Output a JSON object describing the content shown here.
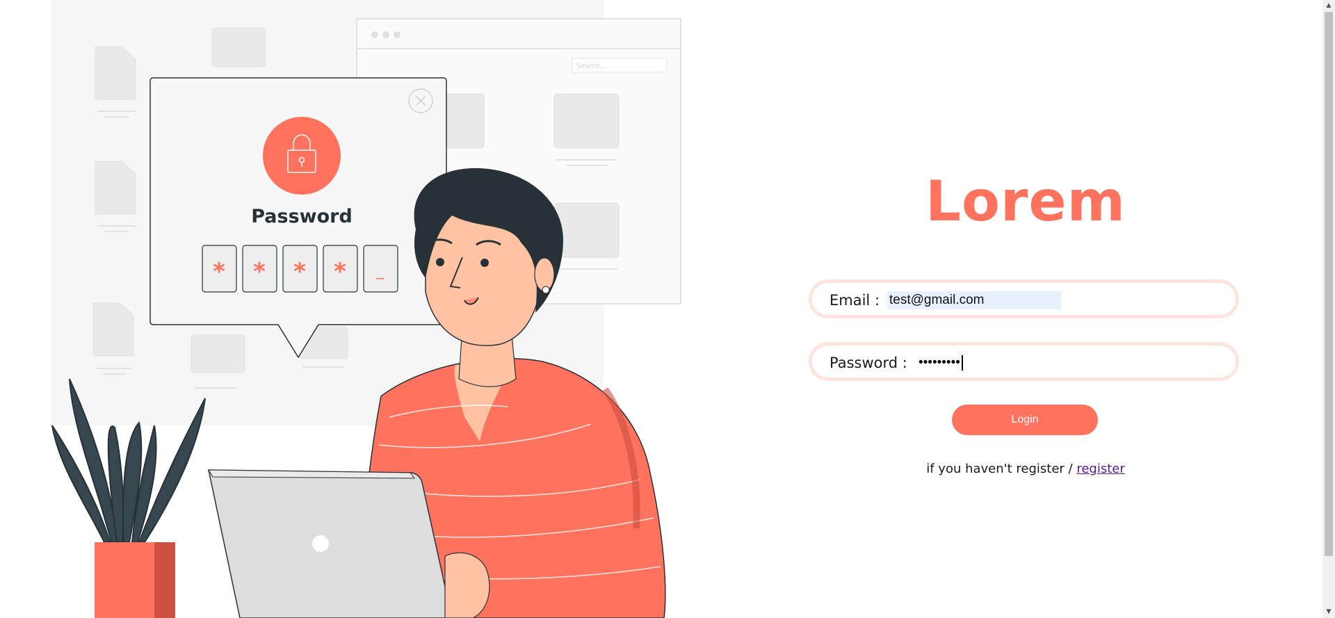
{
  "colors": {
    "accent": "#ff725e",
    "field_border": "#ffe4de",
    "link": "#551a8b",
    "dark": "#263238"
  },
  "illustration": {
    "title": "Password",
    "search_placeholder": "Search...",
    "pin": [
      "*",
      "*",
      "*",
      "*",
      "_"
    ]
  },
  "brand": {
    "title": "Lorem"
  },
  "form": {
    "email_label": "Email :",
    "email_value": "test@gmail.com",
    "password_label": "Password :",
    "password_value": "•••••••••",
    "login_label": "Login"
  },
  "footer": {
    "prompt": "if you haven't register / ",
    "link_label": "register"
  },
  "icons": {
    "lock": "lock-icon",
    "close": "close-icon"
  }
}
